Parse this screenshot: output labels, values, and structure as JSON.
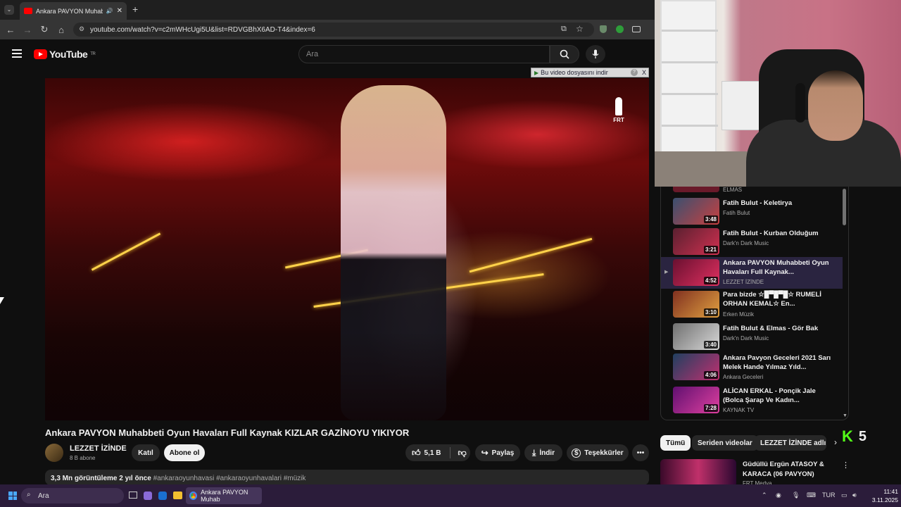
{
  "browser": {
    "tab_title": "Ankara PAVYON Muhabbeti",
    "url": "youtube.com/watch?v=c2mWHcUgi5U&list=RDVGBhX6AD-T4&index=6"
  },
  "youtube": {
    "logo_text": "YouTube",
    "logo_sup": "TR",
    "search_placeholder": "Ara"
  },
  "video": {
    "overlay_banner": "Bu video dosyasını indir",
    "overlay_help": "?",
    "overlay_close": "X",
    "watermark": "FRT",
    "title": "Ankara PAVYON Muhabbeti Oyun Havaları Full Kaynak KIZLAR GAZİNOYU YIKIYOR",
    "channel": "LEZZET İZİNDE",
    "subscribers": "8 B abone",
    "join_label": "Katıl",
    "subscribe_label": "Abone ol",
    "likes": "5,1 B",
    "share_label": "Paylaş",
    "download_label": "İndir",
    "thanks_label": "Teşekkürler",
    "views_line": "3,3 Mn görüntüleme  2 yıl önce",
    "hashtags": "#ankaraoyunhavasi #ankaraoyunhavalari #müzik"
  },
  "playlist": {
    "items": [
      {
        "title": "",
        "channel": "ELMAS",
        "duration": "",
        "active": false
      },
      {
        "title": "Fatih Bulut - Keletirya",
        "channel": "Fatih Bulut",
        "duration": "3:48",
        "active": false,
        "c1": "#3a5070",
        "c2": "#c84040"
      },
      {
        "title": "Fatih Bulut - Kurban Olduğum",
        "channel": "Dark'n Dark Music",
        "duration": "3:21",
        "active": false,
        "c1": "#5a2030",
        "c2": "#d03050"
      },
      {
        "title": "Ankara PAVYON Muhabbeti Oyun Havaları Full Kaynak...",
        "channel": "LEZZET İZİNDE",
        "duration": "4:52",
        "active": true,
        "c1": "#6a1030",
        "c2": "#e03060"
      },
      {
        "title": "Para bizde ☆█▀█▀█☆ RUMELİ ORHAN KEMAL☆ En...",
        "channel": "Erken Müzik",
        "duration": "3:10",
        "active": false,
        "c1": "#803020",
        "c2": "#e0a040"
      },
      {
        "title": "Fatih Bulut & Elmas - Gör Bak",
        "channel": "Dark'n Dark Music",
        "duration": "3:40",
        "active": false,
        "c1": "#707070",
        "c2": "#d8d8d8"
      },
      {
        "title": "Ankara Pavyon Geceleri 2021 Sarı Melek Hande Yılmaz Yıld...",
        "channel": "Ankara Geceleri",
        "duration": "4:06",
        "active": false,
        "c1": "#204060",
        "c2": "#c03070"
      },
      {
        "title": "ALİCAN ERKAL - Ponçik Jale (Bolca Şarap Ve Kadın...",
        "channel": "KAYNAK TV",
        "duration": "7:28",
        "active": false,
        "c1": "#601070",
        "c2": "#e040a0"
      }
    ]
  },
  "chips": [
    "Tümü",
    "Seriden videolar",
    "LEZZET İZİNDE adlı y"
  ],
  "overlay_counter": "5",
  "recommendation": {
    "title": "Güdüllü Ergün ATASOY  &  KARACA          (06 PAVYON)",
    "channel": "FRT Medya"
  },
  "taskbar": {
    "search_label": "Ara",
    "chrome_label": "Ankara PAVYON Muhab",
    "lang": "TUR",
    "time": "11:41",
    "date": "3.11.2025"
  }
}
